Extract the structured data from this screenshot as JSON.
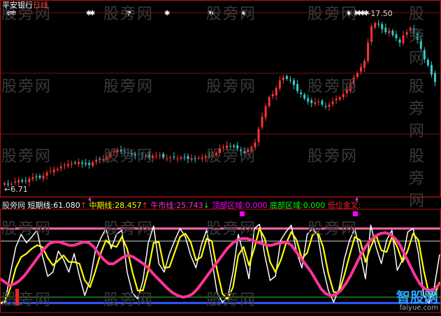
{
  "top_panel": {
    "stock_name": "平安银行",
    "period": "日线",
    "annotations": {
      "high": "17.50",
      "low": "6.71"
    }
  },
  "indicator_panel": {
    "panel_name": "股旁网",
    "legend": [
      {
        "label": "短期线:",
        "value": "61.080",
        "arrow": "↑",
        "color": "#ffffff"
      },
      {
        "label": "中期线:",
        "value": "28.457",
        "arrow": "↑",
        "color": "#ffff00"
      },
      {
        "label": "牛市线:",
        "value": "25.743",
        "arrow": "↓",
        "color": "#ff33cc"
      },
      {
        "label": "顶部区域:",
        "value": "0.000",
        "arrow": "",
        "color": "#ff00ff"
      },
      {
        "label": "底部区域:",
        "value": "0.000",
        "arrow": "",
        "color": "#00ff00"
      },
      {
        "label": "低位金叉:",
        "value": "",
        "arrow": "",
        "color": "#ff2222"
      }
    ]
  },
  "watermark": "股旁网",
  "logo": {
    "name": "智股网",
    "url": "faiyue.com"
  },
  "colors": {
    "background": "#000000",
    "candle_up": "#ff3333",
    "candle_down": "#33cccc",
    "short_line": "#ffffff",
    "mid_line": "#ffff00",
    "bull_line": "#ff3399",
    "top_ref": "#ff66aa",
    "bottom_ref": "#3355ff",
    "grid": "#7a1010"
  },
  "chart_data": [
    {
      "type": "candlestick",
      "title": "平安银行 日线",
      "ylim": [
        6.0,
        18.2
      ],
      "annotations": [
        {
          "label": "17.50",
          "value": 17.5
        },
        {
          "label": "6.71",
          "value": 6.71
        }
      ],
      "close_series": [
        6.9,
        6.8,
        6.85,
        7.0,
        7.1,
        7.0,
        7.05,
        7.2,
        7.3,
        7.3,
        7.25,
        7.4,
        7.6,
        7.7,
        7.8,
        7.85,
        8.0,
        8.1,
        8.15,
        8.2,
        8.25,
        8.3,
        8.2,
        8.15,
        8.1,
        8.3,
        8.45,
        8.5,
        8.5,
        8.6,
        8.9,
        9.0,
        9.1,
        9.0,
        9.0,
        8.9,
        8.8,
        8.75,
        8.8,
        8.7,
        8.7,
        8.65,
        8.7,
        8.7,
        8.75,
        8.6,
        8.55,
        8.6,
        8.6,
        8.55,
        8.6,
        8.6,
        8.5,
        8.55,
        8.5,
        8.6,
        8.6,
        8.7,
        8.7,
        8.8,
        8.9,
        9.2,
        9.3,
        9.4,
        9.35,
        9.3,
        9.2,
        9.0,
        8.9,
        9.1,
        9.3,
        9.6,
        10.5,
        11.3,
        12.0,
        12.6,
        12.8,
        13.2,
        13.7,
        13.9,
        13.8,
        13.7,
        13.4,
        13.0,
        12.8,
        12.5,
        12.3,
        12.2,
        12.25,
        12.3,
        12.1,
        12.0,
        12.1,
        12.3,
        12.5,
        12.6,
        12.8,
        13.1,
        13.5,
        13.9,
        14.2,
        14.6,
        15.0,
        16.2,
        17.3,
        17.5,
        17.4,
        17.1,
        16.9,
        17.0,
        16.7,
        16.5,
        16.2,
        16.7,
        16.9,
        17.2,
        16.8,
        16.4,
        15.8,
        15.1,
        14.7,
        14.1,
        13.6
      ]
    },
    {
      "type": "line",
      "title": "",
      "ylim": [
        0,
        100
      ],
      "reference_lines": [
        92,
        77,
        10,
        3
      ],
      "series": [
        {
          "name": "短期线",
          "color": "#ffffff",
          "values": [
            3,
            6,
            40,
            70,
            85,
            75,
            82,
            90,
            60,
            35,
            40,
            65,
            55,
            40,
            62,
            35,
            12,
            30,
            65,
            80,
            92,
            68,
            85,
            90,
            40,
            15,
            8,
            30,
            75,
            95,
            50,
            40,
            62,
            78,
            92,
            82,
            60,
            45,
            72,
            90,
            55,
            15,
            4,
            10,
            40,
            85,
            60,
            32,
            92,
            97,
            60,
            30,
            35,
            78,
            88,
            96,
            64,
            45,
            85,
            92,
            84,
            45,
            18,
            4,
            20,
            55,
            78,
            92,
            63,
            32,
            96,
            70,
            50,
            78,
            90,
            42,
            55,
            88,
            92,
            62,
            12,
            3,
            22,
            61
          ]
        },
        {
          "name": "中期线",
          "color": "#ffff00",
          "values": [
            2,
            5,
            22,
            45,
            58,
            62,
            68,
            72,
            70,
            57,
            48,
            54,
            60,
            52,
            52,
            50,
            30,
            22,
            41,
            62,
            78,
            72,
            70,
            82,
            68,
            40,
            18,
            18,
            42,
            75,
            76,
            45,
            46,
            64,
            82,
            86,
            76,
            54,
            58,
            80,
            77,
            42,
            14,
            8,
            22,
            60,
            70,
            48,
            68,
            92,
            80,
            52,
            40,
            54,
            74,
            88,
            78,
            56,
            63,
            84,
            88,
            70,
            38,
            16,
            16,
            36,
            60,
            82,
            78,
            52,
            70,
            84,
            66,
            64,
            82,
            70,
            52,
            66,
            86,
            78,
            42,
            14,
            12,
            28
          ]
        },
        {
          "name": "牛市线",
          "color": "#ff3399",
          "values": [
            32,
            28,
            24,
            26,
            30,
            36,
            44,
            52,
            60,
            68,
            74,
            76,
            76,
            74,
            72,
            72,
            74,
            76,
            75,
            70,
            62,
            55,
            50,
            50,
            54,
            58,
            60,
            58,
            54,
            50,
            45,
            38,
            32,
            26,
            20,
            15,
            12,
            10,
            11,
            14,
            20,
            28,
            36,
            44,
            52,
            60,
            68,
            74,
            78,
            80,
            80,
            78,
            76,
            74,
            72,
            72,
            74,
            75,
            76,
            72,
            64,
            56,
            48,
            40,
            30,
            20,
            14,
            12,
            13,
            18,
            26,
            36,
            48,
            60,
            70,
            78,
            83,
            86,
            87,
            85,
            80,
            72,
            60,
            48,
            36,
            26,
            20,
            18,
            20,
            26
          ]
        }
      ]
    }
  ]
}
